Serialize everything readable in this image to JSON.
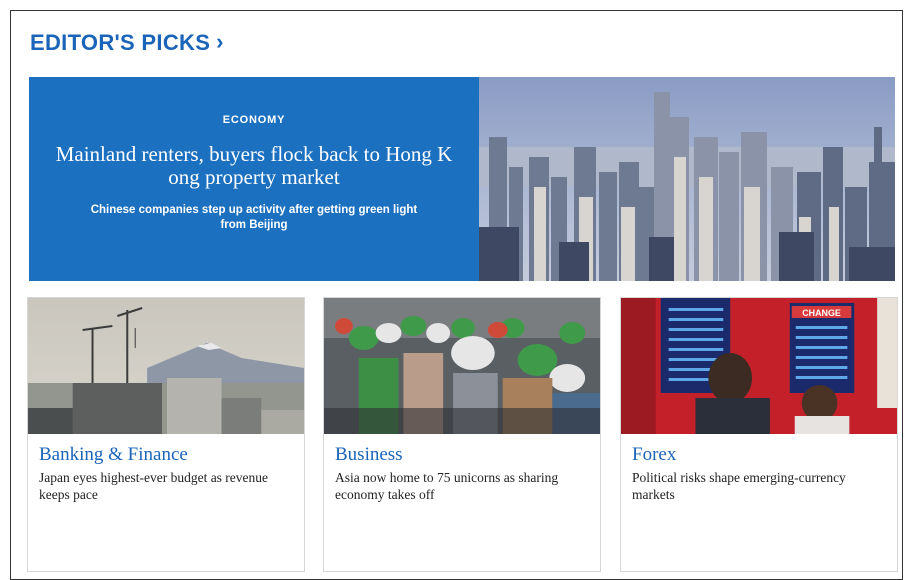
{
  "section": {
    "title": "EDITOR'S PICKS"
  },
  "hero": {
    "category": "ECONOMY",
    "headline": "Mainland renters, buyers flock back to Hong K ong property market",
    "subhead": "Chinese companies step up activity after getting green light from Beijing"
  },
  "cards": [
    {
      "category": "Banking & Finance",
      "headline": "Japan eyes highest-ever budget as revenue keeps pace"
    },
    {
      "category": "Business",
      "headline": "Asia now home to 75 unicorns as sharing economy takes off"
    },
    {
      "category": "Forex",
      "headline": "Political risks shape emerging-currency markets"
    }
  ],
  "icons": {
    "section_arrow": "chevron-right-icon"
  },
  "colors": {
    "brand_blue": "#1a64b9",
    "hero_blue": "#1c70c0"
  }
}
